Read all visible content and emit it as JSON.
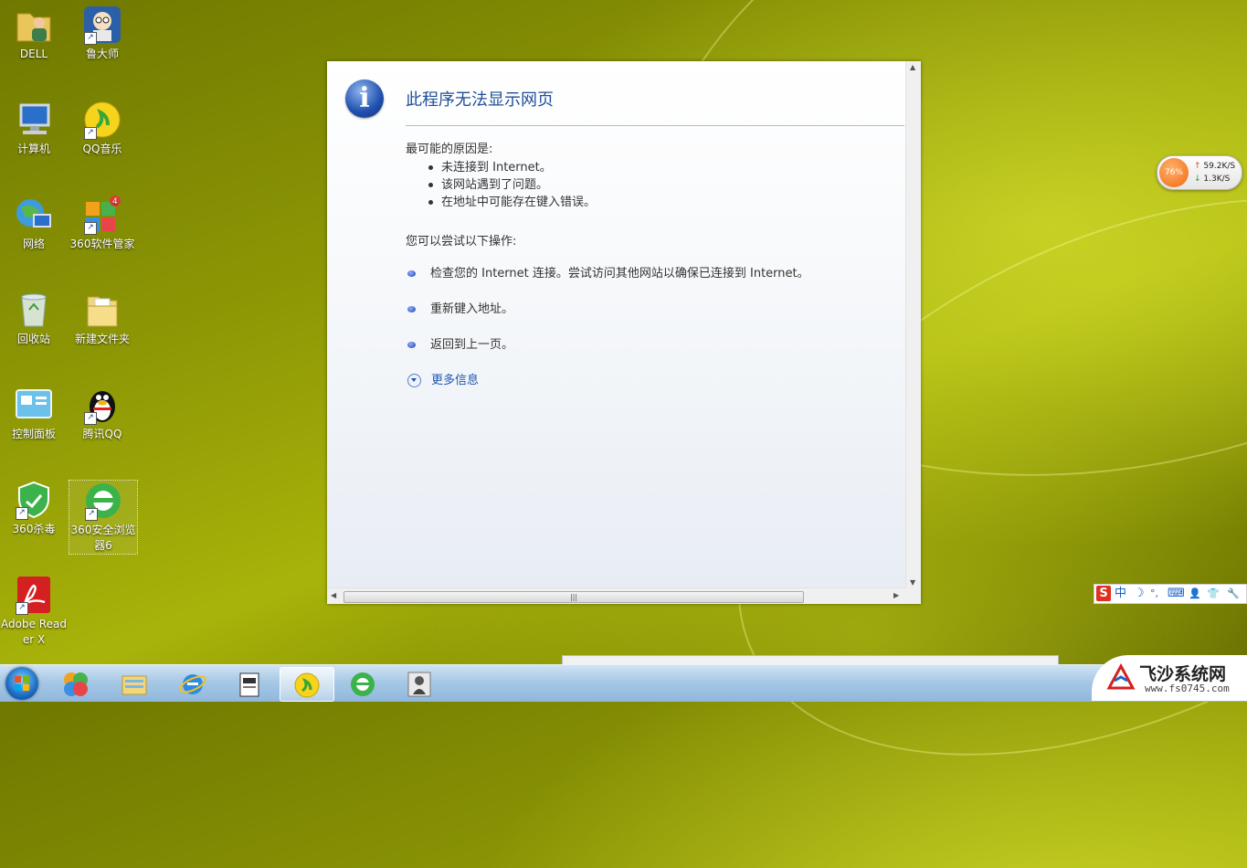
{
  "desktop": {
    "icons": [
      {
        "label": "DELL",
        "icon": "user-folder-icon"
      },
      {
        "label": "鲁大师",
        "icon": "ludashi-icon"
      },
      {
        "label": "计算机",
        "icon": "computer-icon"
      },
      {
        "label": "QQ音乐",
        "icon": "qq-music-icon"
      },
      {
        "label": "网络",
        "icon": "network-icon"
      },
      {
        "label": "360软件管家",
        "icon": "360-software-manager-icon",
        "badge": "4"
      },
      {
        "label": "回收站",
        "icon": "recycle-bin-icon"
      },
      {
        "label": "新建文件夹",
        "icon": "folder-icon"
      },
      {
        "label": "控制面板",
        "icon": "control-panel-icon"
      },
      {
        "label": "腾讯QQ",
        "icon": "qq-penguin-icon"
      },
      {
        "label": "360杀毒",
        "icon": "360-antivirus-icon"
      },
      {
        "label": "360安全浏览器6",
        "icon": "360-browser-icon"
      },
      {
        "label": "Adobe Reader X",
        "icon": "adobe-reader-icon"
      }
    ]
  },
  "error_page": {
    "title": "此程序无法显示网页",
    "causes_heading": "最可能的原因是:",
    "causes": [
      "未连接到 Internet。",
      "该网站遇到了问题。",
      "在地址中可能存在键入错误。"
    ],
    "actions_heading": "您可以尝试以下操作:",
    "actions": [
      "检查您的 Internet 连接。尝试访问其他网站以确保已连接到 Internet。",
      "重新键入地址。",
      "返回到上一页。"
    ],
    "more_info": "更多信息"
  },
  "network_widget": {
    "percent": "76%",
    "upload": "59.2K/S",
    "download": "1.3K/S"
  },
  "ime_bar": {
    "items": [
      "S",
      "中",
      "☽",
      "°,",
      "⌨",
      "👤",
      "👕",
      "🔧"
    ]
  },
  "taskbar": {
    "items": [
      {
        "icon": "start-orb-icon"
      },
      {
        "icon": "360-software-manager-icon"
      },
      {
        "icon": "windows-explorer-icon"
      },
      {
        "icon": "internet-explorer-icon"
      },
      {
        "icon": "notepad-document-icon"
      },
      {
        "icon": "qq-music-icon",
        "active": true
      },
      {
        "icon": "360-browser-icon"
      },
      {
        "icon": "photo-viewer-icon"
      }
    ]
  },
  "watermark": {
    "name": "飞沙系统网",
    "url": "www.fs0745.com"
  },
  "colors": {
    "title_blue": "#1f4e99",
    "link_blue": "#1f56b0",
    "desktop_green": "#a8b30a"
  }
}
